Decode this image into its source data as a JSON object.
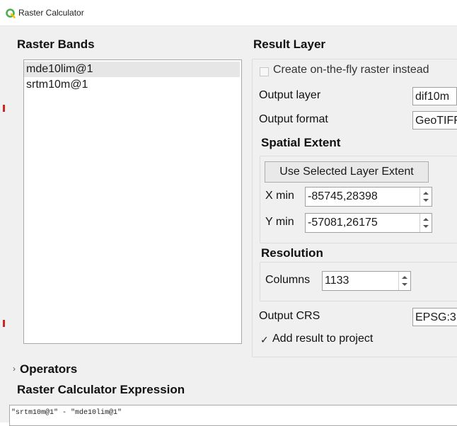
{
  "window": {
    "title": "Raster Calculator",
    "icon": "qgis-logo-icon"
  },
  "raster_bands": {
    "heading": "Raster Bands",
    "items": [
      "mde10lim@1",
      "srtm10m@1"
    ],
    "selected_index": 0
  },
  "result_layer": {
    "heading": "Result Layer",
    "on_the_fly_label": "Create on-the-fly raster instead",
    "on_the_fly_checked": false,
    "output_layer_label": "Output layer",
    "output_layer_value": "dif10m",
    "output_format_label": "Output format",
    "output_format_value": "GeoTIFF",
    "spatial_extent": {
      "heading": "Spatial Extent",
      "use_selected_button": "Use Selected Layer Extent",
      "xmin_label": "X min",
      "xmin_value": "-85745,28398",
      "ymin_label": "Y min",
      "ymin_value": "-57081,26175"
    },
    "resolution": {
      "heading": "Resolution",
      "columns_label": "Columns",
      "columns_value": "1133"
    },
    "output_crs_label": "Output CRS",
    "output_crs_value": "EPSG:3",
    "add_result_label": "Add result to project",
    "add_result_checked": true,
    "checkmark": "✓"
  },
  "operators": {
    "label": "Operators",
    "collapsed_marker": "›"
  },
  "expression": {
    "heading": "Raster Calculator Expression",
    "value": "\"srtm10m@1\" - \"mde10lim@1\""
  },
  "colors": {
    "dialog_bg": "#f0f0f0",
    "qgis_green": "#4caf50",
    "qgis_yellow": "#f2c200"
  }
}
